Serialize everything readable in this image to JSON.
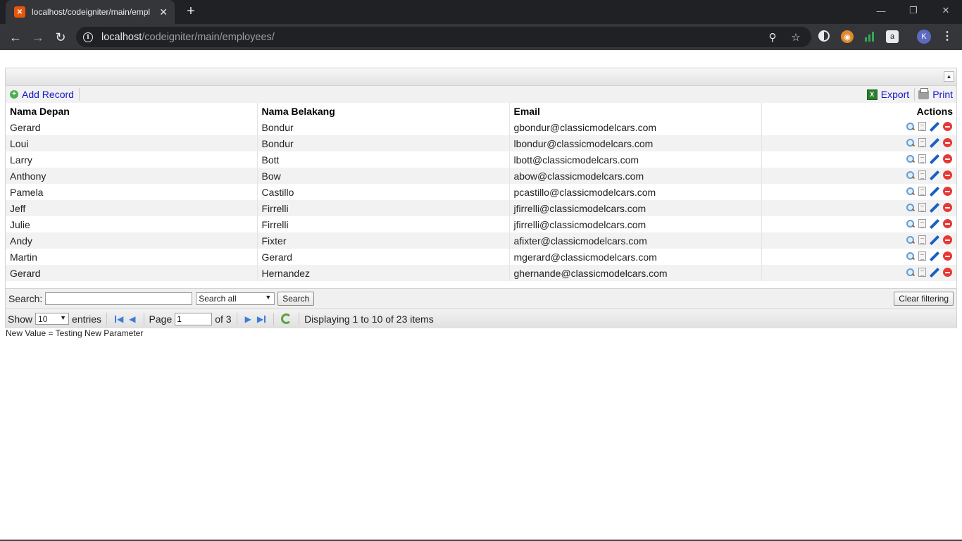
{
  "browser": {
    "tab_title": "localhost/codeigniter/main/empl",
    "tab_favicon": "xampp-icon",
    "url_host": "localhost",
    "url_path": "/codeigniter/main/employees/",
    "avatar_initial": "K"
  },
  "toolbar": {
    "add_label": "Add Record",
    "export_label": "Export",
    "print_label": "Print"
  },
  "table": {
    "headers": {
      "first": "Nama Depan",
      "last": "Nama Belakang",
      "email": "Email",
      "actions": "Actions"
    },
    "rows": [
      {
        "first": "Gerard",
        "last": "Bondur",
        "email": "gbondur@classicmodelcars.com"
      },
      {
        "first": "Loui",
        "last": "Bondur",
        "email": "lbondur@classicmodelcars.com"
      },
      {
        "first": "Larry",
        "last": "Bott",
        "email": "lbott@classicmodelcars.com"
      },
      {
        "first": "Anthony",
        "last": "Bow",
        "email": "abow@classicmodelcars.com"
      },
      {
        "first": "Pamela",
        "last": "Castillo",
        "email": "pcastillo@classicmodelcars.com"
      },
      {
        "first": "Jeff",
        "last": "Firrelli",
        "email": "jfirrelli@classicmodelcars.com"
      },
      {
        "first": "Julie",
        "last": "Firrelli",
        "email": "jfirrelli@classicmodelcars.com"
      },
      {
        "first": "Andy",
        "last": "Fixter",
        "email": "afixter@classicmodelcars.com"
      },
      {
        "first": "Martin",
        "last": "Gerard",
        "email": "mgerard@classicmodelcars.com"
      },
      {
        "first": "Gerard",
        "last": "Hernandez",
        "email": "ghernande@classicmodelcars.com"
      }
    ]
  },
  "search": {
    "label": "Search:",
    "value": "",
    "field_selected": "Search all",
    "button_label": "Search",
    "clear_label": "Clear filtering"
  },
  "pager": {
    "show_label": "Show",
    "per_page": "10",
    "entries_label": "entries",
    "page_label": "Page",
    "current_page": "1",
    "of_label": "of 3",
    "display_text": "Displaying 1 to 10 of 23 items"
  },
  "note": "New Value = Testing New Parameter"
}
